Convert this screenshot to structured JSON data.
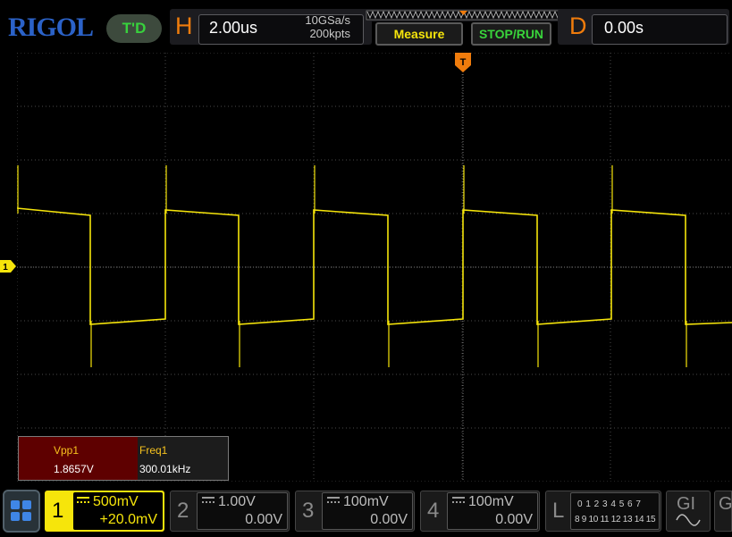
{
  "brand": {
    "logo": "RIGOL",
    "logo_color": "#2b62c8"
  },
  "trigger_status": "T'D",
  "horizontal": {
    "label": "H",
    "timebase": "2.00us",
    "sample_rate": "10GSa/s",
    "memory_depth": "200kpts"
  },
  "buttons": {
    "measure": "Measure",
    "stop_run": "STOP/RUN"
  },
  "delay": {
    "label": "D",
    "value": "0.00s"
  },
  "screen": {
    "trigger_marker": "T",
    "channel_marker": "1",
    "grid_divisions": {
      "horizontal": 10,
      "vertical": 8
    },
    "waveform_color": "#f6e50b"
  },
  "measurements": [
    {
      "label": "Vpp1",
      "value": "1.8657V"
    },
    {
      "label": "Freq1",
      "value": "300.01kHz"
    }
  ],
  "channels": [
    {
      "num": "1",
      "scale": "500mV",
      "offset": "+20.0mV",
      "active": true,
      "color": "#f6e50b"
    },
    {
      "num": "2",
      "scale": "1.00V",
      "offset": "0.00V",
      "active": false
    },
    {
      "num": "3",
      "scale": "100mV",
      "offset": "0.00V",
      "active": false
    },
    {
      "num": "4",
      "scale": "100mV",
      "offset": "0.00V",
      "active": false
    }
  ],
  "logic": {
    "label": "L",
    "row1": "0 1 2 3  4 5 6 7",
    "row2": "8 9 10 11 12 13 14 15"
  },
  "gen": {
    "label": "GI",
    "label2": "G"
  }
}
